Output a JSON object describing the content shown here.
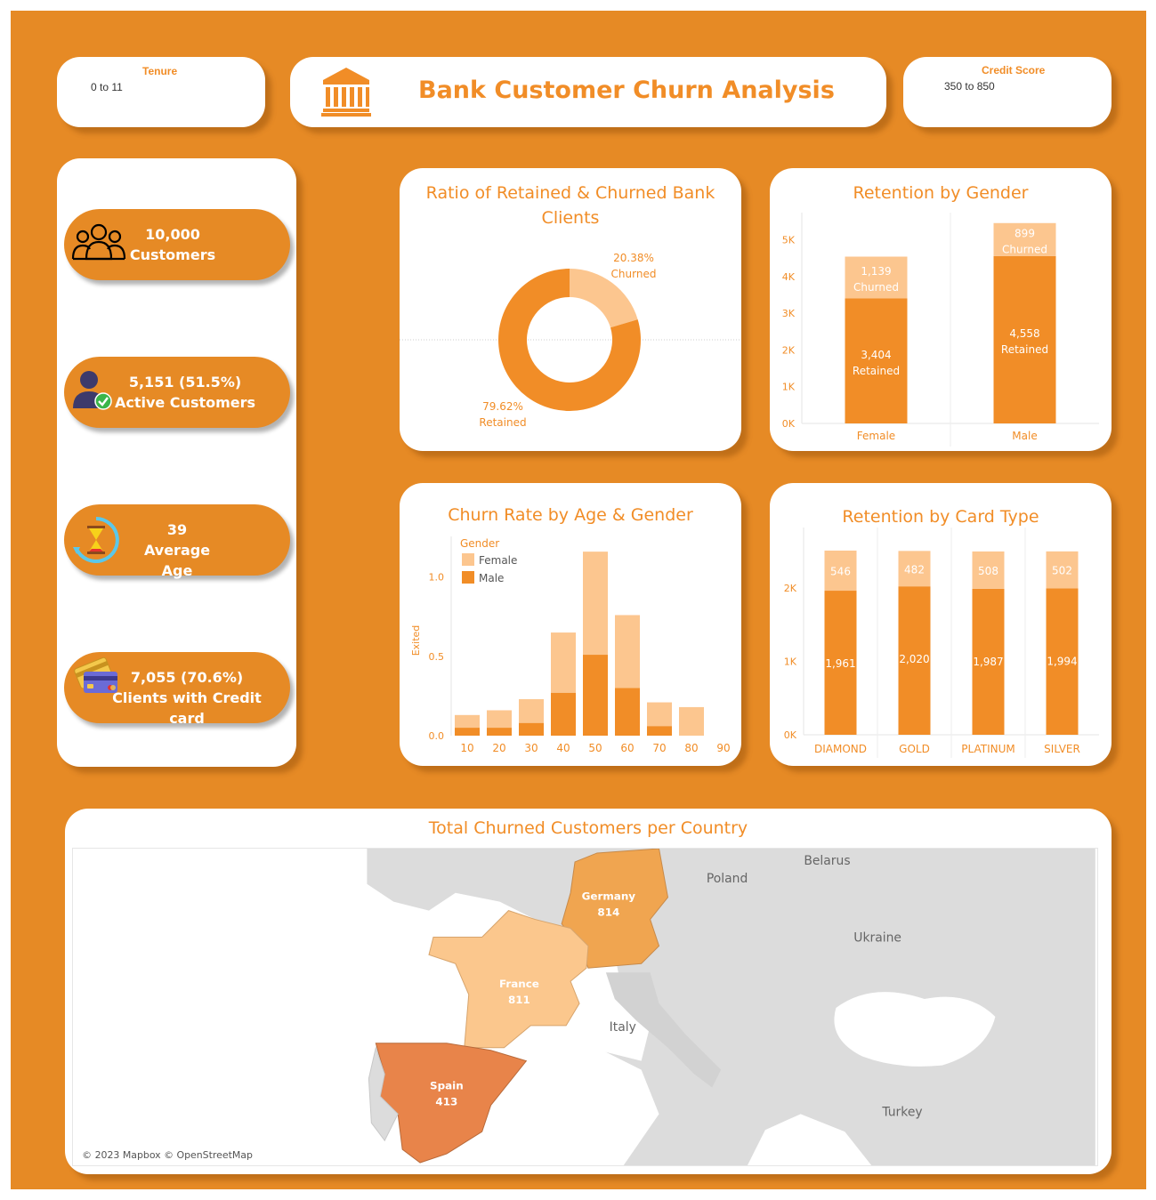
{
  "header": {
    "title": "Bank Customer Churn Analysis",
    "filters": {
      "tenure": {
        "label": "Tenure",
        "value": "0 to 11"
      },
      "credit_score": {
        "label": "Credit Score",
        "value": "350 to 850"
      }
    },
    "icon": "bank-icon"
  },
  "kpis": [
    {
      "value": "10,000",
      "label": "Customers",
      "icon": "customers-icon"
    },
    {
      "value": "5,151 (51.5%)",
      "label": "Active Customers",
      "icon": "active-user-icon"
    },
    {
      "value": "39",
      "label": "Average Age",
      "icon": "hourglass-icon"
    },
    {
      "value": "7,055 (70.6%)",
      "label": "Clients with Credit card",
      "icon": "credit-card-icon"
    }
  ],
  "colors": {
    "background": "#e68a25",
    "accent": "#f18d27",
    "light": "#fcc68f",
    "map_light": "#fbc78d",
    "map_mid": "#f0a550",
    "map_dark": "#e8844a"
  },
  "chart_data": [
    {
      "type": "pie",
      "title": "Ratio of Retained & Churned Bank Clients",
      "slices": [
        {
          "name": "Churned",
          "value": 20.38,
          "label": "20.38%"
        },
        {
          "name": "Retained",
          "value": 79.62,
          "label": "79.62%"
        }
      ]
    },
    {
      "type": "bar",
      "stacked": true,
      "title": "Retention by Gender",
      "categories": [
        "Female",
        "Male"
      ],
      "series": [
        {
          "name": "Retained",
          "values": [
            3404,
            4558
          ],
          "labels": [
            "3,404",
            "4,558"
          ]
        },
        {
          "name": "Churned",
          "values": [
            1139,
            899
          ],
          "labels": [
            "1,139",
            "899"
          ]
        }
      ],
      "ylim": [
        0,
        5500
      ],
      "yticks": [
        "0K",
        "1K",
        "2K",
        "3K",
        "4K",
        "5K"
      ]
    },
    {
      "type": "bar",
      "stacked": true,
      "title": "Churn Rate by Age & Gender",
      "ylabel": "Exited",
      "legend_title": "Gender",
      "legend_position": "top-left",
      "categories": [
        "10",
        "20",
        "30",
        "40",
        "50",
        "60",
        "70",
        "80",
        "90"
      ],
      "series": [
        {
          "name": "Male",
          "values": [
            0.05,
            0.05,
            0.08,
            0.27,
            0.51,
            0.3,
            0.06,
            0.0,
            0.0
          ]
        },
        {
          "name": "Female",
          "values": [
            0.08,
            0.11,
            0.15,
            0.38,
            0.65,
            0.46,
            0.15,
            0.18,
            0.0
          ]
        }
      ],
      "ylim": [
        0,
        1.2
      ],
      "yticks": [
        "0.0",
        "0.5",
        "1.0"
      ]
    },
    {
      "type": "bar",
      "stacked": true,
      "title": "Retention by Card Type",
      "categories": [
        "DIAMOND",
        "GOLD",
        "PLATINUM",
        "SILVER"
      ],
      "series": [
        {
          "name": "Retained",
          "values": [
            1961,
            2020,
            1987,
            1994
          ],
          "labels": [
            "1,961",
            "2,020",
            "1,987",
            "1,994"
          ]
        },
        {
          "name": "Churned",
          "values": [
            546,
            482,
            508,
            502
          ],
          "labels": [
            "546",
            "482",
            "508",
            "502"
          ]
        }
      ],
      "ylim": [
        0,
        2700
      ],
      "yticks": [
        "0K",
        "1K",
        "2K"
      ]
    }
  ],
  "map": {
    "title": "Total Churned Customers per Country",
    "countries": [
      {
        "name": "Germany",
        "value": "814"
      },
      {
        "name": "France",
        "value": "811"
      },
      {
        "name": "Spain",
        "value": "413"
      }
    ],
    "labels": [
      "Belarus",
      "Poland",
      "Ukraine",
      "Italy",
      "Turkey"
    ],
    "attribution": "© 2023 Mapbox © OpenStreetMap"
  }
}
